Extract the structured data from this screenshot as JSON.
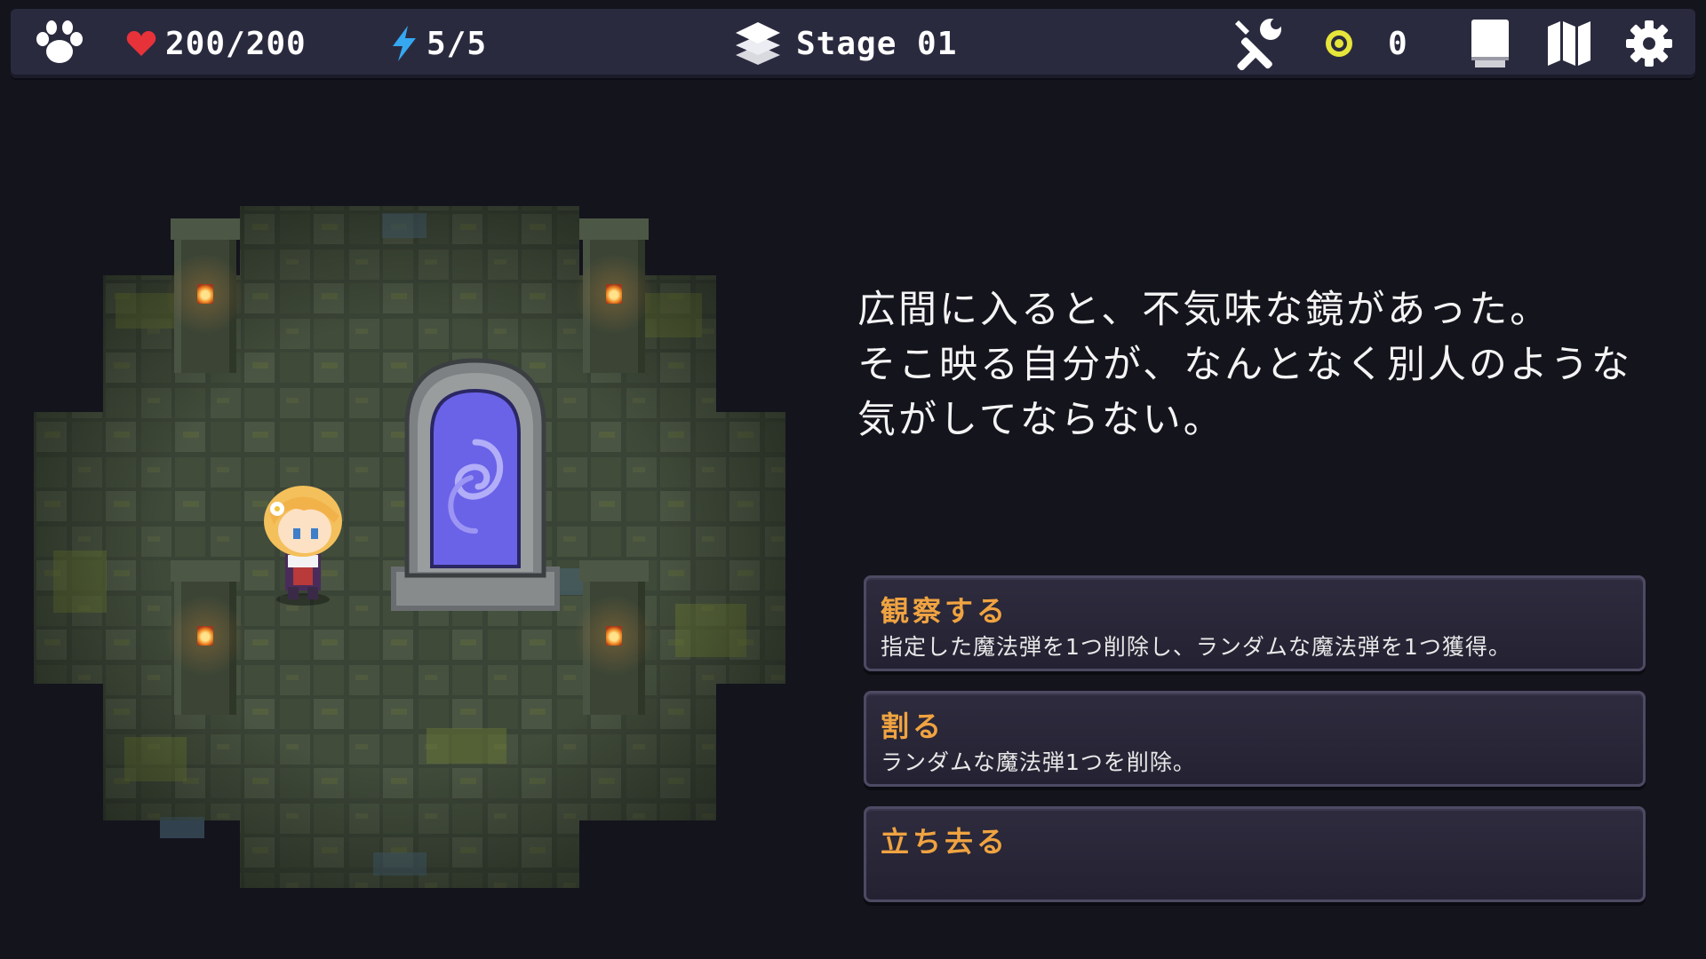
{
  "topbar": {
    "hp": "200/200",
    "energy": "5/5",
    "stage": "Stage 01",
    "coins": "0",
    "icons": {
      "pet": "paw-icon",
      "hp": "heart-icon",
      "energy": "lightning-icon",
      "stage": "layers-icon",
      "tools": "tools-icon",
      "coin": "coin-icon",
      "deck": "book-icon",
      "map": "map-icon",
      "settings": "gear-icon"
    }
  },
  "narrative": {
    "lines": [
      "広間に入ると、不気味な鏡があった。",
      "そこ映る自分が、なんとなく別人のような",
      "気がしてならない。"
    ]
  },
  "choices": [
    {
      "title": "観察する",
      "desc": "指定した魔法弾を1つ削除し、ランダムな魔法弾を1つ獲得。"
    },
    {
      "title": "割る",
      "desc": "ランダムな魔法弾1つを削除。"
    },
    {
      "title": "立ち去る",
      "desc": ""
    }
  ],
  "colors": {
    "accent": "#f0a341",
    "heart": "#e8323a",
    "energy": "#35a8f0",
    "coin": "#e6e53a",
    "mirror": "#6a63e8"
  }
}
